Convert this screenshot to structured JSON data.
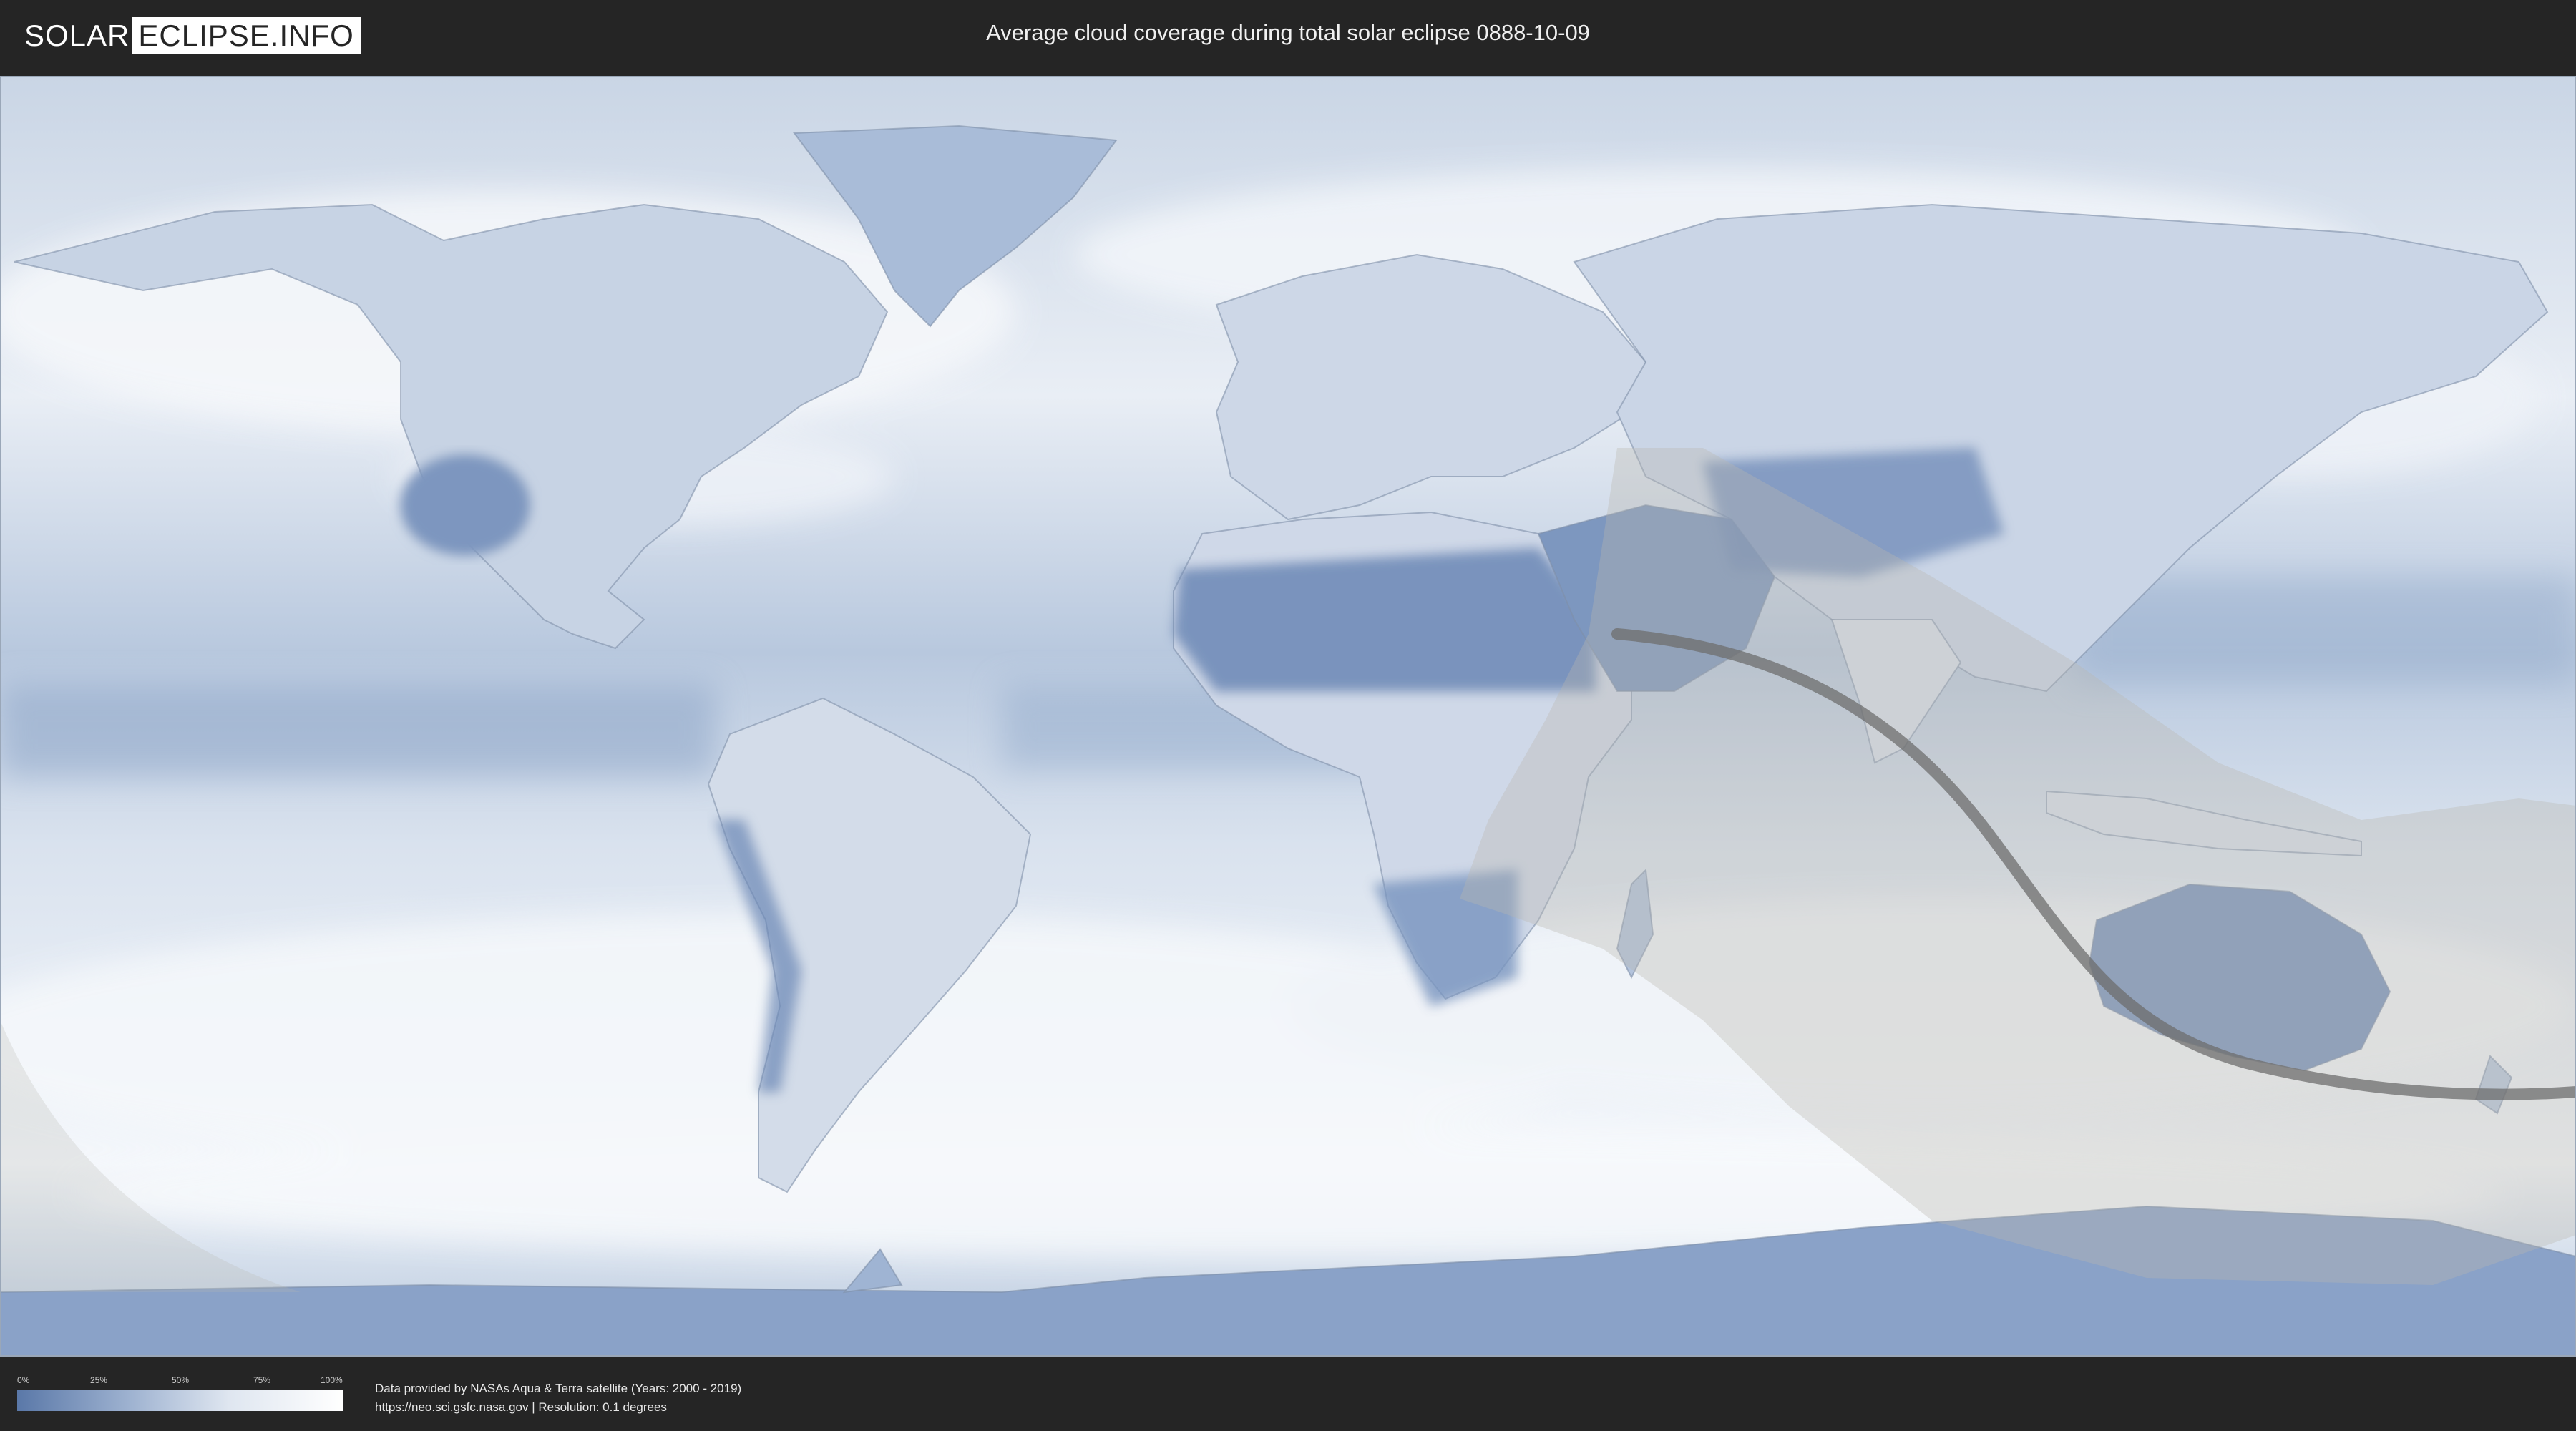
{
  "header": {
    "logo_part1": "SOLAR",
    "logo_part2": "ECLIPSE.INFO",
    "title": "Average cloud coverage during total solar eclipse 0888-10-09"
  },
  "map": {
    "ocean_color": "#d5deea",
    "cloud_color": "#f3f6fa",
    "clear_sky_color": "#5e7cae",
    "penumbra_color": "#b9b7b0",
    "central_line_color": "#6d6d6d"
  },
  "legend": {
    "ticks": [
      "0%",
      "25%",
      "50%",
      "75%",
      "100%"
    ],
    "gradient_start": "#5a78a8",
    "gradient_end": "#ffffff"
  },
  "footer": {
    "credit_line1": "Data provided by NASAs Aqua & Terra satellite (Years: 2000 - 2019)",
    "credit_line2": "https://neo.sci.gsfc.nasa.gov | Resolution: 0.1 degrees"
  }
}
